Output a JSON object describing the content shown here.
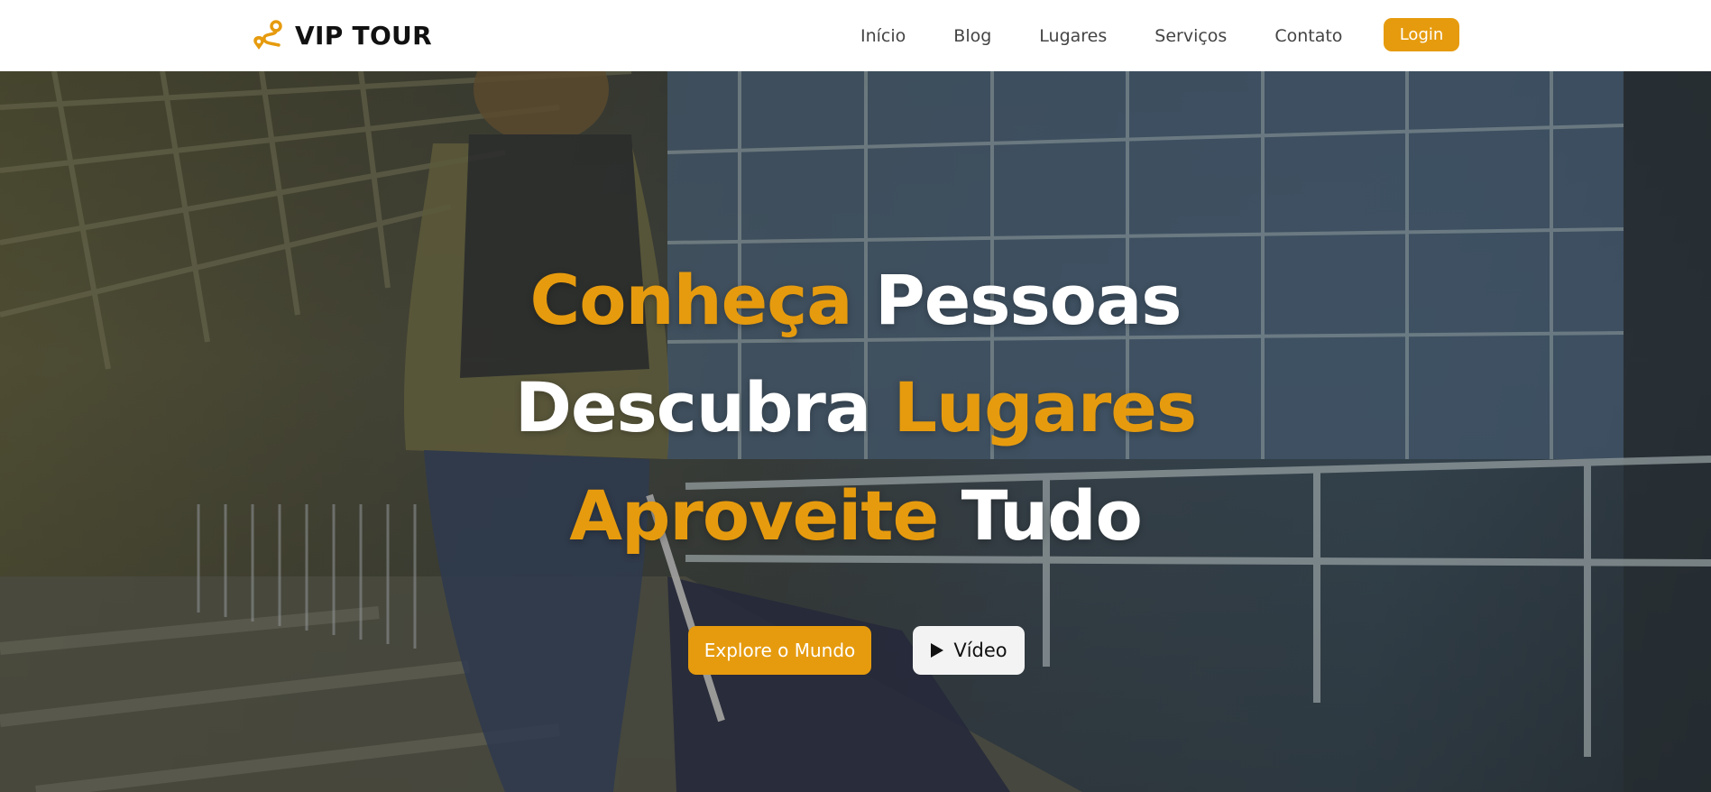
{
  "brand": {
    "name": "VIP TOUR",
    "icon": "route-pin-icon",
    "accent_color": "#e69b0e"
  },
  "nav": {
    "items": [
      {
        "label": "Início"
      },
      {
        "label": "Blog"
      },
      {
        "label": "Lugares"
      },
      {
        "label": "Serviços"
      },
      {
        "label": "Contato"
      }
    ],
    "login_label": "Login"
  },
  "hero": {
    "line1": {
      "accent": "Conheça",
      "rest": "Pessoas"
    },
    "line2": {
      "lead": "Descubra",
      "accent": "Lugares"
    },
    "line3": {
      "accent": "Aproveite",
      "rest": "Tudo"
    },
    "primary_cta": "Explore o Mundo",
    "secondary_cta": "Vídeo",
    "secondary_cta_icon": "play-icon",
    "background": "traveler-with-backpack-and-suitcase-at-airport-photo"
  }
}
